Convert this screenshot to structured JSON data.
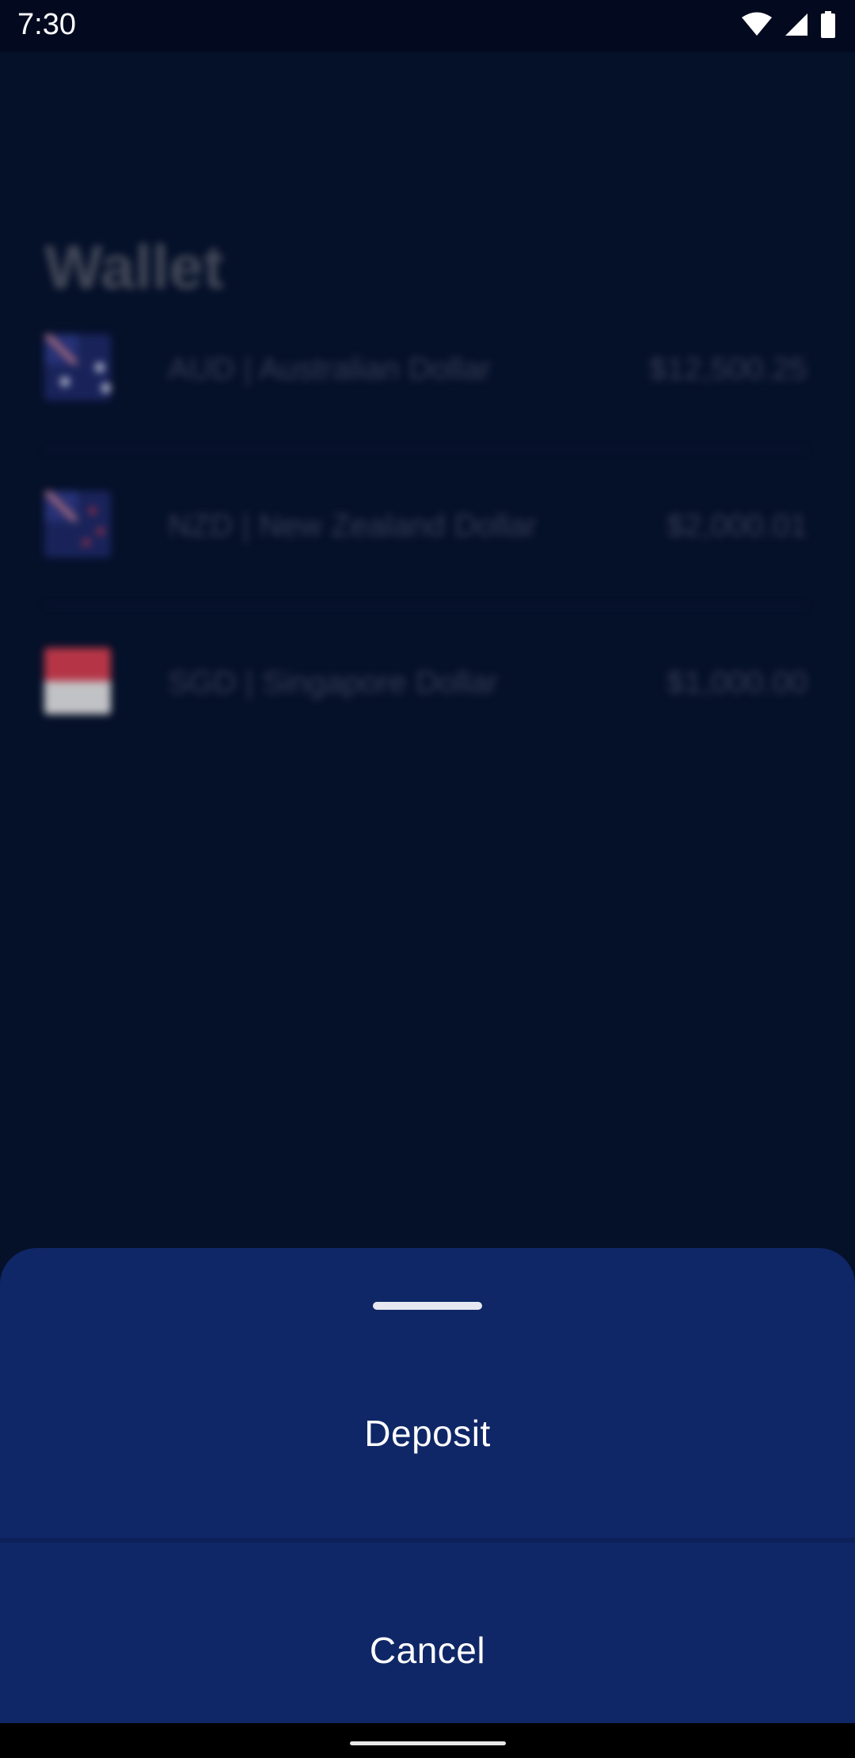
{
  "status_bar": {
    "time": "7:30",
    "icons": [
      "wifi-icon",
      "signal-icon",
      "battery-icon"
    ]
  },
  "wallet": {
    "title": "Wallet",
    "items": [
      {
        "flag": "australia-flag-icon",
        "name": "AUD | Australian Dollar",
        "amount": "$12,500.25"
      },
      {
        "flag": "new-zealand-flag-icon",
        "name": "NZD | New Zealand Dollar",
        "amount": "$2,000.01"
      },
      {
        "flag": "singapore-flag-icon",
        "name": "SGD | Singapore Dollar",
        "amount": "$1,000.00"
      }
    ]
  },
  "sheet": {
    "deposit_label": "Deposit",
    "cancel_label": "Cancel"
  },
  "colors": {
    "background": "#051029",
    "sheet": "#0f2766",
    "text": "#ffffff"
  }
}
